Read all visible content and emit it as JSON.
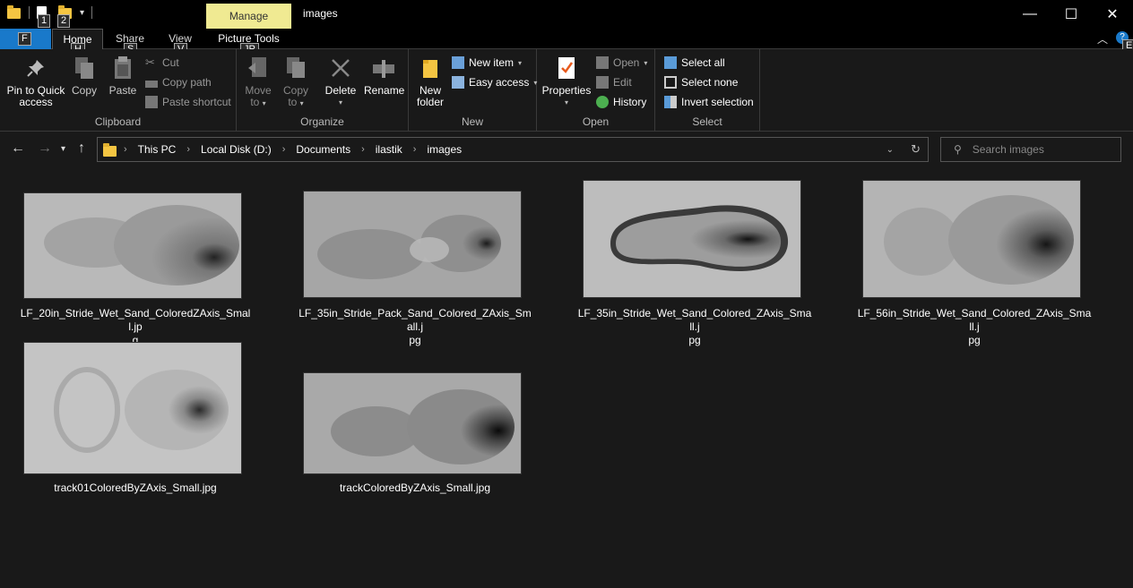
{
  "titlebar": {
    "title": "images",
    "manage_tab": "Manage",
    "keytips": {
      "qat1": "1",
      "qat2": "2"
    },
    "controls": {
      "minimize": "—",
      "maximize": "☐",
      "close": "✕"
    }
  },
  "tabs": {
    "file_keytip": "F",
    "home": "Home",
    "home_keytip": "H",
    "share": "Share",
    "share_keytip": "S",
    "view": "View",
    "view_keytip": "V",
    "picture_tools": "Picture Tools",
    "picture_tools_keytip": "JP",
    "help_keytip": "E"
  },
  "ribbon": {
    "clipboard": {
      "label": "Clipboard",
      "pin_line1": "Pin to Quick",
      "pin_line2": "access",
      "copy": "Copy",
      "paste": "Paste",
      "cut": "Cut",
      "copy_path": "Copy path",
      "paste_shortcut": "Paste shortcut"
    },
    "organize": {
      "label": "Organize",
      "move_to_line1": "Move",
      "move_to_line2": "to",
      "copy_to_line1": "Copy",
      "copy_to_line2": "to",
      "delete": "Delete",
      "rename": "Rename"
    },
    "new": {
      "label": "New",
      "new_folder_line1": "New",
      "new_folder_line2": "folder",
      "new_item": "New item",
      "easy_access": "Easy access"
    },
    "open": {
      "label": "Open",
      "properties": "Properties",
      "open": "Open",
      "edit": "Edit",
      "history": "History"
    },
    "select": {
      "label": "Select",
      "select_all": "Select all",
      "select_none": "Select none",
      "invert_selection": "Invert selection"
    }
  },
  "address": {
    "crumbs": [
      "This PC",
      "Local Disk (D:)",
      "Documents",
      "ilastik",
      "images"
    ],
    "search_placeholder": "Search images"
  },
  "files": [
    {
      "line1": "LF_20in_Stride_Wet_Sand_ColoredZAxis_Small.jp",
      "line2": "g"
    },
    {
      "line1": "LF_35in_Stride_Pack_Sand_Colored_ZAxis_Small.j",
      "line2": "pg"
    },
    {
      "line1": "LF_35in_Stride_Wet_Sand_Colored_ZAxis_Small.j",
      "line2": "pg"
    },
    {
      "line1": "LF_56in_Stride_Wet_Sand_Colored_ZAxis_Small.j",
      "line2": "pg"
    },
    {
      "line1": "track01ColoredByZAxis_Small.jpg",
      "line2": ""
    },
    {
      "line1": "trackColoredByZAxis_Small.jpg",
      "line2": ""
    }
  ]
}
